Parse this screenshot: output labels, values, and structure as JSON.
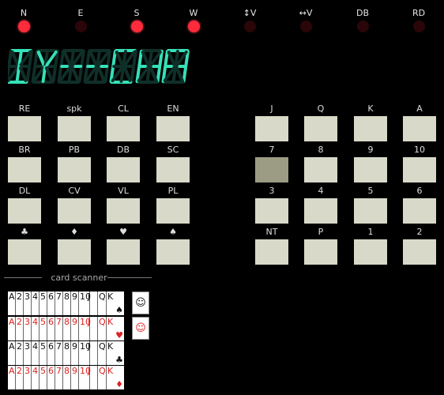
{
  "lamps": [
    {
      "label": "N",
      "on": true
    },
    {
      "label": "E",
      "on": false
    },
    {
      "label": "S",
      "on": true
    },
    {
      "label": "W",
      "on": true
    },
    {
      "label": "↕V",
      "on": false
    },
    {
      "label": "↔V",
      "on": false
    },
    {
      "label": "DB",
      "on": false
    },
    {
      "label": "RD",
      "on": false
    }
  ],
  "display": {
    "text": "IY--CHA",
    "color": "#36e0b8",
    "dim_color": "#0f2f28"
  },
  "keypad_left": [
    [
      "RE",
      "spk",
      "CL",
      "EN"
    ],
    [
      "BR",
      "PB",
      "DB",
      "SC"
    ],
    [
      "DL",
      "CV",
      "VL",
      "PL"
    ],
    [
      "♣",
      "♦",
      "♥",
      "♠"
    ]
  ],
  "keypad_right": [
    [
      "J",
      "Q",
      "K",
      "A"
    ],
    [
      "7",
      "8",
      "9",
      "10"
    ],
    [
      "3",
      "4",
      "5",
      "6"
    ],
    [
      "NT",
      "P",
      "1",
      "2"
    ]
  ],
  "keypad_right_active": "7",
  "scanner": {
    "label": "card scanner",
    "ranks": [
      "A",
      "2",
      "3",
      "4",
      "5",
      "6",
      "7",
      "8",
      "9",
      "10",
      "J",
      "Q",
      "K"
    ],
    "suits": [
      {
        "symbol": "♠",
        "color": "black"
      },
      {
        "symbol": "♥",
        "color": "red"
      },
      {
        "symbol": "♣",
        "color": "black"
      },
      {
        "symbol": "♦",
        "color": "red"
      }
    ],
    "jokers": [
      {
        "symbol": "☺",
        "color": "black"
      },
      {
        "symbol": "☺",
        "color": "red"
      }
    ]
  }
}
